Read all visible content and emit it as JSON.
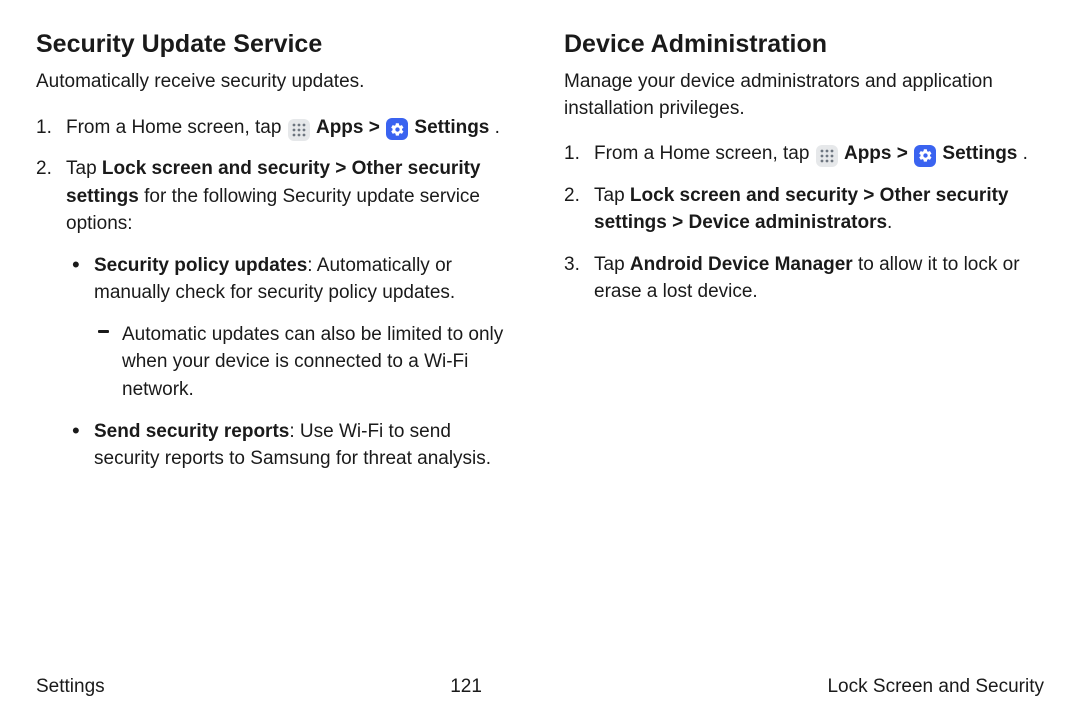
{
  "left": {
    "heading": "Security Update Service",
    "subtitle": "Automatically receive security updates.",
    "step1_a": "From a Home screen, tap ",
    "step1_apps": "Apps",
    "step1_sep": " > ",
    "step1_settings": "Settings",
    "step1_end": " .",
    "step2_a": "Tap ",
    "step2_b": "Lock screen and security > Other security settings",
    "step2_c": " for the following Security update service options:",
    "bullet1_a": "Security policy updates",
    "bullet1_b": ": Automatically or manually check for security policy updates.",
    "dash1": "Automatic updates can also be limited to only when your device is connected to a Wi-Fi network.",
    "bullet2_a": "Send security reports",
    "bullet2_b": ": Use Wi-Fi to send security reports to Samsung for threat analysis."
  },
  "right": {
    "heading": "Device Administration",
    "subtitle": "Manage your device administrators and application installation privileges.",
    "step1_a": "From a Home screen, tap ",
    "step1_apps": "Apps",
    "step1_sep": "  > ",
    "step1_settings": "Settings",
    "step1_end": " .",
    "step2_a": "Tap ",
    "step2_b": "Lock screen and security > Other security settings > Device administrators",
    "step2_c": ".",
    "step3_a": "Tap ",
    "step3_b": "Android Device Manager",
    "step3_c": " to allow it to lock or erase a lost device."
  },
  "footer": {
    "left": "Settings",
    "center": "121",
    "right": "Lock Screen and Security"
  }
}
